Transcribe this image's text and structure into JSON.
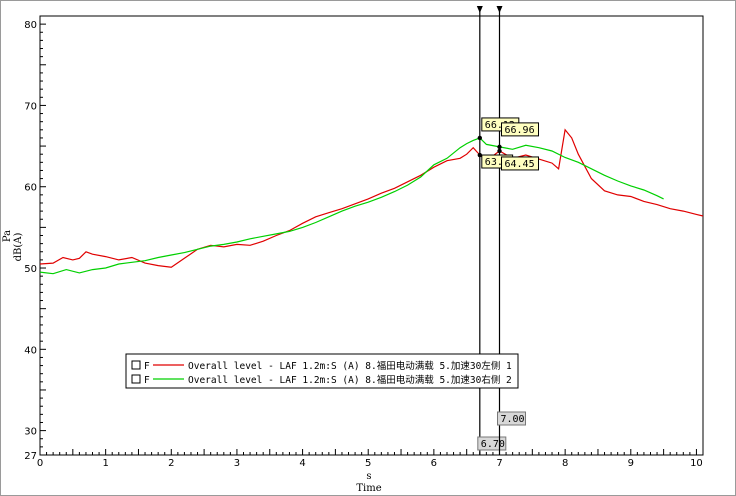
{
  "chart_data": {
    "type": "line",
    "xlabel_unit": "s",
    "xlabel": "Time",
    "ylabel_unit": "Pa",
    "ylabel": "dB(A)",
    "xlim": [
      0,
      10.1
    ],
    "ylim": [
      27,
      81
    ],
    "x_ticks": [
      0,
      1,
      2,
      3,
      4,
      5,
      6,
      7,
      8,
      9,
      10
    ],
    "y_ticks": [
      27,
      30,
      40,
      50,
      60,
      70,
      80
    ],
    "grid": true,
    "legend_position": "bottom-center",
    "series": [
      {
        "legend_marker": "F",
        "name": "Overall level - LAF 1.2m:S (A) 8.福田电动满载 5.加速30左侧 1",
        "color": "#e00000",
        "x": [
          0,
          0.2,
          0.35,
          0.5,
          0.6,
          0.7,
          0.8,
          1.0,
          1.2,
          1.4,
          1.6,
          1.8,
          2.0,
          2.2,
          2.4,
          2.6,
          2.8,
          3.0,
          3.2,
          3.4,
          3.6,
          3.8,
          4.0,
          4.2,
          4.4,
          4.6,
          4.8,
          5.0,
          5.2,
          5.4,
          5.6,
          5.8,
          6.0,
          6.2,
          6.4,
          6.5,
          6.6,
          6.7,
          6.8,
          7.0,
          7.2,
          7.4,
          7.6,
          7.8,
          7.9,
          8.0,
          8.1,
          8.2,
          8.4,
          8.6,
          8.8,
          9.0,
          9.2,
          9.4,
          9.6,
          9.8,
          10.0,
          10.1
        ],
        "y": [
          50.5,
          50.6,
          51.3,
          51.0,
          51.2,
          52.0,
          51.7,
          51.4,
          51.0,
          51.3,
          50.6,
          50.3,
          50.1,
          51.2,
          52.3,
          52.8,
          52.6,
          52.9,
          52.8,
          53.3,
          54.0,
          54.6,
          55.5,
          56.3,
          56.8,
          57.3,
          57.9,
          58.5,
          59.2,
          59.8,
          60.6,
          61.4,
          62.4,
          63.2,
          63.5,
          64.0,
          64.8,
          63.9,
          63.2,
          64.4,
          63.5,
          63.9,
          63.4,
          62.9,
          62.2,
          67.0,
          66.0,
          64.0,
          61.0,
          59.5,
          59.0,
          58.8,
          58.2,
          57.8,
          57.3,
          57.0,
          56.6,
          56.4
        ],
        "cursor_values": [
          "63.7",
          "64.45"
        ]
      },
      {
        "legend_marker": "F",
        "name": "Overall level - LAF 1.2m:S (A) 8.福田电动满载 5.加速30右侧 2",
        "color": "#00d000",
        "x": [
          0,
          0.2,
          0.4,
          0.6,
          0.8,
          1.0,
          1.2,
          1.4,
          1.6,
          1.8,
          2.0,
          2.2,
          2.4,
          2.6,
          2.8,
          3.0,
          3.2,
          3.4,
          3.6,
          3.8,
          4.0,
          4.2,
          4.4,
          4.6,
          4.8,
          5.0,
          5.2,
          5.4,
          5.6,
          5.8,
          6.0,
          6.2,
          6.4,
          6.5,
          6.6,
          6.7,
          6.8,
          7.0,
          7.2,
          7.4,
          7.6,
          7.8,
          8.0,
          8.2,
          8.4,
          8.6,
          8.8,
          9.0,
          9.2,
          9.4,
          9.5
        ],
        "y": [
          49.5,
          49.3,
          49.8,
          49.4,
          49.8,
          50.0,
          50.5,
          50.7,
          50.9,
          51.3,
          51.6,
          51.9,
          52.3,
          52.7,
          52.9,
          53.2,
          53.6,
          53.9,
          54.2,
          54.5,
          55.0,
          55.6,
          56.3,
          57.0,
          57.6,
          58.1,
          58.7,
          59.4,
          60.2,
          61.2,
          62.7,
          63.5,
          64.8,
          65.3,
          65.7,
          66.0,
          65.2,
          64.9,
          64.6,
          65.1,
          64.8,
          64.4,
          63.6,
          63.0,
          62.2,
          61.4,
          60.7,
          60.1,
          59.6,
          58.9,
          58.5
        ],
        "cursor_values": [
          "66.12",
          "66.96"
        ]
      }
    ],
    "cursors": [
      {
        "x": 6.7,
        "label": "6.70"
      },
      {
        "x": 7.0,
        "label": "7.00"
      }
    ]
  }
}
